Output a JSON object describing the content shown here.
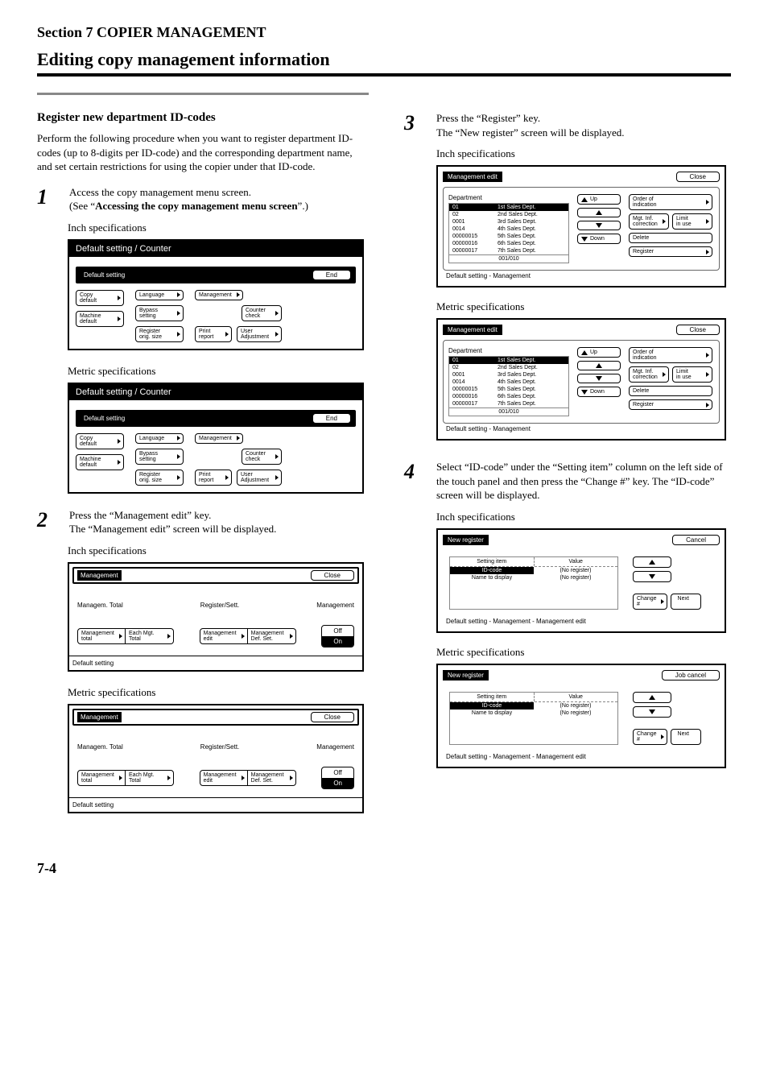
{
  "section_header": "Section 7  COPIER MANAGEMENT",
  "title": "Editing copy management information",
  "register_subtitle": "Register new department ID-codes",
  "register_body": "Perform the following procedure when you want to register department ID-codes (up to 8-digits per ID-code) and the corresponding department name, and set certain restrictions for using the copier under that ID-code.",
  "step1": {
    "num": "1",
    "line1": "Access the copy management menu screen.",
    "line2_pre": "(See “",
    "line2_bold": "Accessing the copy management menu screen",
    "line2_post": "”.)",
    "inch_label": "Inch specifications",
    "metric_label": "Metric specifications"
  },
  "step2": {
    "num": "2",
    "line1": "Press the “Management edit” key.",
    "line2": "The “Management edit” screen will be displayed.",
    "inch_label": "Inch specifications",
    "metric_label": "Metric specifications"
  },
  "step3": {
    "num": "3",
    "line1": "Press the “Register” key.",
    "line2": "The “New register” screen will be displayed.",
    "inch_label": "Inch specifications",
    "metric_label": "Metric specifications"
  },
  "step4": {
    "num": "4",
    "body": "Select “ID-code” under the “Setting item” column on the left side of the touch panel and then press the “Change #” key. The “ID-code” screen will be displayed.",
    "inch_label": "Inch specifications",
    "metric_label": "Metric specifications"
  },
  "dsc_fig": {
    "title": "Default setting / Counter",
    "default_label": "Default setting",
    "end": "End",
    "copy_default": "Copy\ndefault",
    "machine_default": "Machine\ndefault",
    "language": "Language",
    "bypass": "Bypass\nsetting",
    "register_orig": "Register\norig. size",
    "management": "Management",
    "counter_check": "Counter\ncheck",
    "print_report": "Print\nreport",
    "user_adjust": "User\nAdjustment"
  },
  "mgmt_fig": {
    "title": "Management",
    "close": "Close",
    "managem_total": "Managem. Total",
    "register_sett": "Register/Sett.",
    "mgmt_label": "Management",
    "mgmt_total": "Management\ntotal",
    "each_mgt": "Each Mgt.\nTotal",
    "mgmt_edit": "Management\nedit",
    "mgmt_def": "Management\nDef. Set.",
    "off": "Off",
    "on": "On",
    "footer": "Default setting"
  },
  "me_fig": {
    "title": "Management edit",
    "close": "Close",
    "department": "Department",
    "rows": [
      [
        "01",
        "1st Sales Dept."
      ],
      [
        "02",
        "2nd Sales Dept."
      ],
      [
        "0001",
        "3rd Sales Dept."
      ],
      [
        "0014",
        "4th Sales Dept."
      ],
      [
        "00000015",
        "5th Sales Dept."
      ],
      [
        "00000016",
        "6th Sales Dept."
      ],
      [
        "00000017",
        "7th Sales Dept."
      ]
    ],
    "count": "001/010",
    "up": "Up",
    "down": "Down",
    "order": "Order of\nindication",
    "mgt_inf": "Mgt. Inf.\ncorrection",
    "limit": "Limit\nin use",
    "delete": "Delete",
    "register": "Register",
    "footer": "Default setting - Management"
  },
  "nr_fig": {
    "title": "New register",
    "cancel_inch": "Cancel",
    "cancel_metric": "Job cancel",
    "setting_item": "Setting item",
    "value": "Value",
    "id_code": "ID-code",
    "no_register": "(No register)",
    "name_to_display": "Name to display",
    "change": "Change #",
    "next": "Next",
    "footer": "Default setting - Management - Management edit"
  },
  "page_number": "7-4"
}
